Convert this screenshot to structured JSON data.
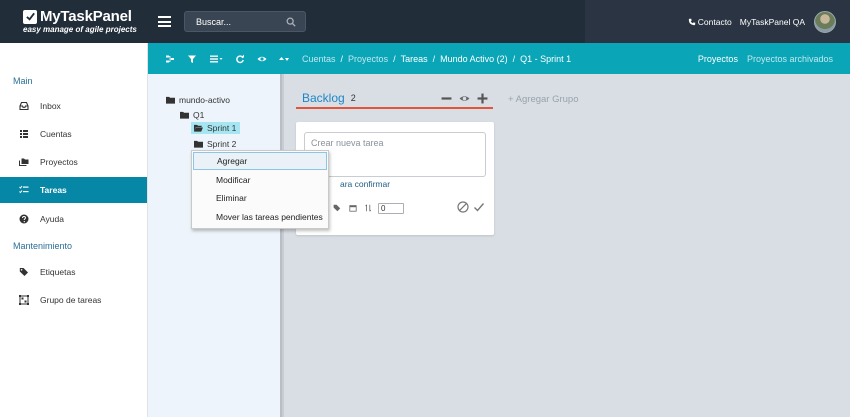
{
  "app": {
    "logo_name": "MyTaskPanel",
    "tagline": "easy manage of agile projects"
  },
  "header": {
    "search": {
      "placeholder": "Buscar..."
    },
    "contact": "Contacto",
    "user_name": "MyTaskPanel QA"
  },
  "toolbar": {
    "tools": [
      "group-icon",
      "filter-icon",
      "list-icon",
      "refresh-icon",
      "eye-icon",
      "sort-icon"
    ]
  },
  "breadcrumb": {
    "items": [
      "Cuentas",
      "Proyectos",
      "Tareas",
      "Mundo Activo (2)",
      "Q1 - Sprint 1"
    ],
    "separator": "/"
  },
  "subtabs": {
    "active": "Proyectos",
    "other": "Proyectos archivados"
  },
  "sidebar": {
    "section_main": "Main",
    "section_maint": "Mantenimiento",
    "items": [
      {
        "label": "Inbox",
        "icon": "inbox-icon"
      },
      {
        "label": "Cuentas",
        "icon": "list-icon"
      },
      {
        "label": "Proyectos",
        "icon": "folders-icon"
      },
      {
        "label": "Tareas",
        "icon": "tasks-icon",
        "active": true
      },
      {
        "label": "Ayuda",
        "icon": "help-icon"
      },
      {
        "label": "Etiquetas",
        "icon": "tags-icon"
      },
      {
        "label": "Grupo de tareas",
        "icon": "group-icon"
      }
    ]
  },
  "tree": {
    "root": "mundo-activo",
    "child": "Q1",
    "sprints": [
      "Sprint 1",
      "Sprint 2"
    ]
  },
  "context_menu": {
    "items": [
      "Agregar",
      "Modificar",
      "Eliminar",
      "Mover las tareas pendientes"
    ]
  },
  "board": {
    "group_title": "Backlog",
    "group_count": "2",
    "add_group": "+ Agregar Grupo",
    "new_task_placeholder": "Crear nueva tarea",
    "confirm_hint": "ara confirmar",
    "estimate_value": "0"
  },
  "colors": {
    "header_bg": "#222d3a",
    "toolbar_bg": "#0ba5b8",
    "active_nav": "#0787a6",
    "group_underline": "#e3553a",
    "group_title": "#1d86c8"
  }
}
